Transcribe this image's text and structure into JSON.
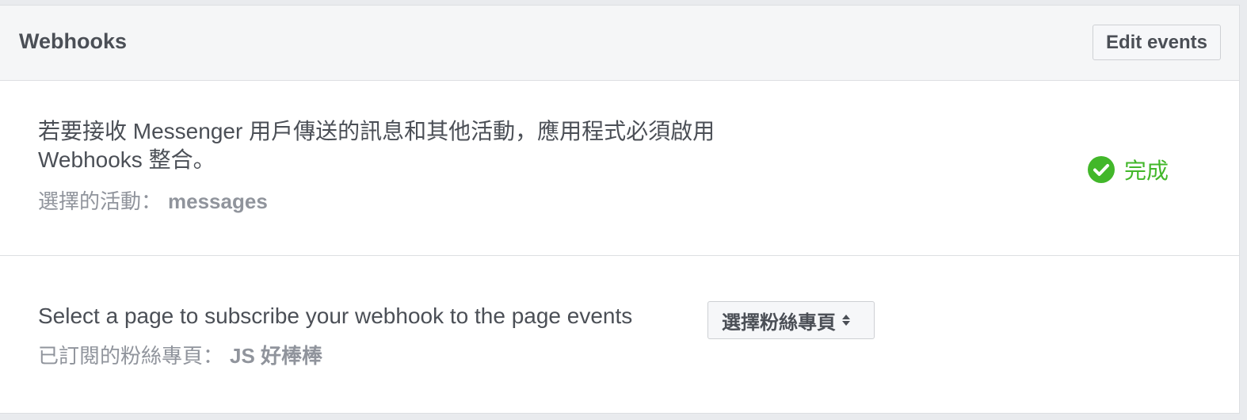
{
  "header": {
    "title": "Webhooks",
    "edit_label": "Edit events"
  },
  "webhook_section": {
    "description": "若要接收 Messenger 用戶傳送的訊息和其他活動，應用程式必須啟用 Webhooks 整合。",
    "selected_label": "選擇的活動：",
    "selected_value": "messages",
    "status_label": "完成",
    "status_icon": "check-circle-icon",
    "status_color": "#42b72a"
  },
  "subscribe_section": {
    "text": "Select a page to subscribe your webhook to the page events",
    "select_label": "選擇粉絲專頁",
    "subscribed_label": "已訂閱的粉絲專頁：",
    "subscribed_value": "JS 好棒棒"
  }
}
